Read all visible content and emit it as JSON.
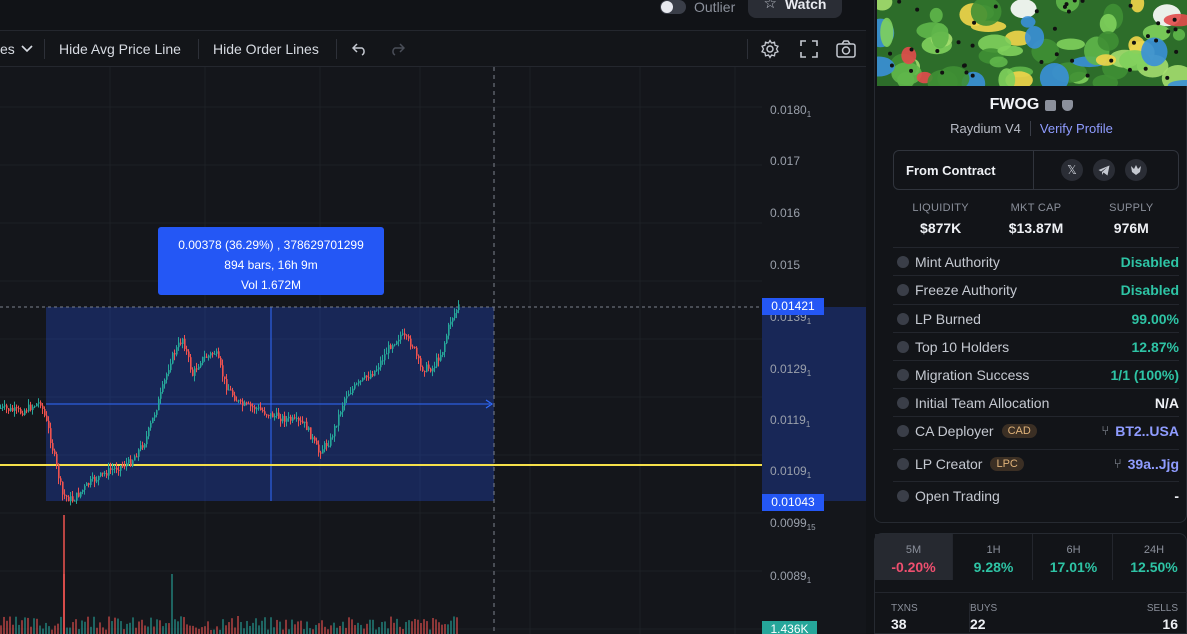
{
  "topbar": {
    "outlier_label": "Outlier",
    "watch_label": "Watch"
  },
  "toolbar": {
    "dropdown_fragment": "es",
    "hide_avg_label": "Hide Avg Price Line",
    "hide_order_label": "Hide Order Lines"
  },
  "chart": {
    "price_axis": [
      "0.0180",
      "0.017",
      "0.016",
      "0.015",
      "0.0139",
      "0.0129",
      "0.0119",
      "0.0109",
      "0.0099",
      "0.0089"
    ],
    "price_axis_subscripts": [
      "1",
      "",
      "",
      "",
      "1",
      "1",
      "1",
      "1",
      "15",
      "1"
    ],
    "measure": {
      "line1": "0.00378 (36.29%) , 378629701299",
      "line2": "894 bars, 16h 9m",
      "line3": "Vol 1.672M"
    },
    "top_price_tag": "0.01421",
    "bottom_price_tag": "0.01043",
    "volume_tag": "1.436K",
    "colors": {
      "up": "#26a69a",
      "down": "#ef5350",
      "accent": "#2457f5",
      "avg_line": "#f5e04a"
    }
  },
  "token": {
    "name": "FWOG",
    "dex": "Raydium V4",
    "verify_label": "Verify Profile",
    "contract_label": "From Contract",
    "social_icons": [
      "x-icon",
      "telegram-icon",
      "dexscreener-icon"
    ]
  },
  "stats": [
    {
      "label": "LIQUIDITY",
      "value": "$877K"
    },
    {
      "label": "MKT CAP",
      "value": "$13.87M"
    },
    {
      "label": "SUPPLY",
      "value": "976M"
    }
  ],
  "audit": [
    {
      "label": "Mint Authority",
      "value": "Disabled",
      "color": "#2ec4a5"
    },
    {
      "label": "Freeze Authority",
      "value": "Disabled",
      "color": "#2ec4a5"
    },
    {
      "label": "LP Burned",
      "value": "99.00%",
      "color": "#2ec4a5"
    },
    {
      "label": "Top 10 Holders",
      "value": "12.87%",
      "color": "#2ec4a5"
    },
    {
      "label": "Migration Success",
      "value": "1/1 (100%)",
      "color": "#2ec4a5"
    },
    {
      "label": "Initial Team Allocation",
      "value": "N/A",
      "color": "#eef0f4"
    },
    {
      "label": "CA Deployer",
      "badge": "CAD",
      "value": "BT2..USA",
      "color": "#8f9cff"
    },
    {
      "label": "LP Creator",
      "badge": "LPC",
      "value": "39a..Jjg",
      "color": "#8f9cff"
    },
    {
      "label": "Open Trading",
      "value": "-",
      "color": "#eef0f4"
    }
  ],
  "timeframes": [
    {
      "label": "5M",
      "value": "-0.20%",
      "color": "#ef4f6f"
    },
    {
      "label": "1H",
      "value": "9.28%",
      "color": "#2ec4a5"
    },
    {
      "label": "6H",
      "value": "17.01%",
      "color": "#2ec4a5"
    },
    {
      "label": "24H",
      "value": "12.50%",
      "color": "#2ec4a5"
    }
  ],
  "txns": [
    {
      "label": "TXNS",
      "value": "38"
    },
    {
      "label": "BUYS",
      "value": "22"
    },
    {
      "label": "SELLS",
      "value": "16"
    }
  ]
}
